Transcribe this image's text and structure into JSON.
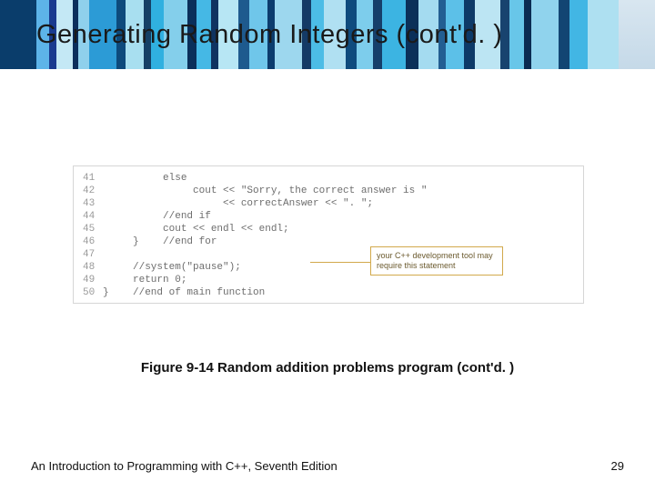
{
  "slide": {
    "title": "Generating Random Integers (cont'd. )",
    "figure_caption": "Figure 9-14 Random addition problems program (cont'd. )",
    "footer_text": "An Introduction to Programming with C++, Seventh Edition",
    "page_number": "29"
  },
  "code": {
    "lines": [
      {
        "num": "41",
        "text": "          else"
      },
      {
        "num": "42",
        "text": "               cout << \"Sorry, the correct answer is \""
      },
      {
        "num": "43",
        "text": "                    << correctAnswer << \". \";"
      },
      {
        "num": "44",
        "text": "          //end if"
      },
      {
        "num": "45",
        "text": "          cout << endl << endl;"
      },
      {
        "num": "46",
        "text": "     }    //end for"
      },
      {
        "num": "47",
        "text": ""
      },
      {
        "num": "48",
        "text": "     //system(\"pause\");"
      },
      {
        "num": "49",
        "text": "     return 0;"
      },
      {
        "num": "50",
        "text": "}    //end of main function"
      }
    ],
    "callout": "your C++ development tool may require this statement"
  }
}
